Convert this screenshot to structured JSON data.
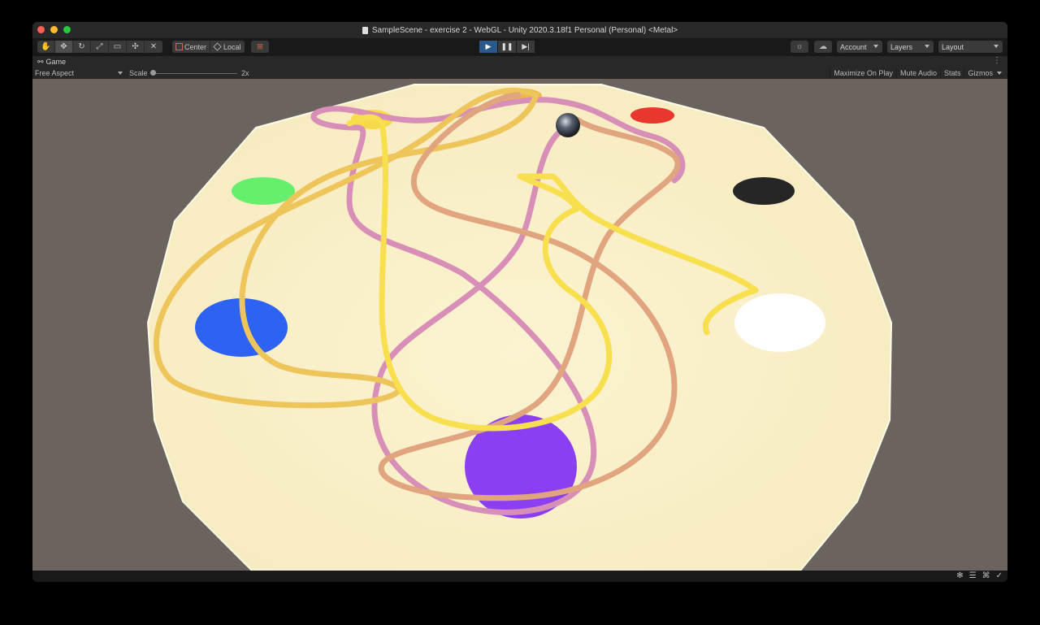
{
  "window": {
    "title": "SampleScene - exercise 2 - WebGL - Unity 2020.3.18f1 Personal (Personal) <Metal>",
    "traffic_colors": [
      "#ff5f57",
      "#febc2e",
      "#28c840"
    ]
  },
  "toolbar": {
    "tools": [
      {
        "name": "hand-tool",
        "icon": "hand-icon",
        "glyph": "✋"
      },
      {
        "name": "move-tool",
        "icon": "move-icon",
        "glyph": "✥"
      },
      {
        "name": "rotate-tool",
        "icon": "rotate-icon",
        "glyph": "↻"
      },
      {
        "name": "scale-tool",
        "icon": "scale-icon",
        "glyph": "⤢"
      },
      {
        "name": "rect-tool",
        "icon": "rect-icon",
        "glyph": "▭"
      },
      {
        "name": "transform-tool",
        "icon": "transform-icon",
        "glyph": "✣"
      },
      {
        "name": "custom-tool",
        "icon": "custom-tool-icon",
        "glyph": "✕"
      }
    ],
    "pivot_label": "Center",
    "space_label": "Local",
    "snap_icon": "grid-snap-icon",
    "play_icon": "play-icon",
    "pause_icon": "pause-icon",
    "step_icon": "step-icon",
    "collab_icon": "sun-icon",
    "cloud_icon": "cloud-icon",
    "account_label": "Account",
    "layers_label": "Layers",
    "layout_label": "Layout"
  },
  "game_tab": {
    "label": "Game",
    "icon": "gamepad-icon"
  },
  "game_bar": {
    "aspect_label": "Free Aspect",
    "scale_label": "Scale",
    "scale_value": "2x",
    "maximize_label": "Maximize On Play",
    "mute_label": "Mute Audio",
    "stats_label": "Stats",
    "gizmos_label": "Gizmos"
  },
  "scene": {
    "background_color": "#6b635d",
    "table_color": "#fbf3d1",
    "ball_color": "#5a6270",
    "targets": [
      {
        "name": "yellow-target",
        "color": "#f7d94a"
      },
      {
        "name": "orange-target",
        "color": "#f2b54a"
      },
      {
        "name": "red-target",
        "color": "#e8372d"
      },
      {
        "name": "green-target",
        "color": "#66ef6c"
      },
      {
        "name": "black-target",
        "color": "#262626"
      },
      {
        "name": "blue-target",
        "color": "#2d62f2"
      },
      {
        "name": "white-target",
        "color": "#ffffff"
      },
      {
        "name": "purple-target",
        "color": "#8c3ff0"
      }
    ],
    "paths": [
      {
        "name": "pink-path",
        "color": "#d88fb7"
      },
      {
        "name": "mustard-path",
        "color": "#eec55a"
      },
      {
        "name": "peach-path",
        "color": "#e0a57f"
      },
      {
        "name": "yellow-path",
        "color": "#f7df4e"
      }
    ]
  },
  "status_icons": [
    "bug-icon",
    "layers-stack-icon",
    "network-icon",
    "check-circle-icon"
  ]
}
